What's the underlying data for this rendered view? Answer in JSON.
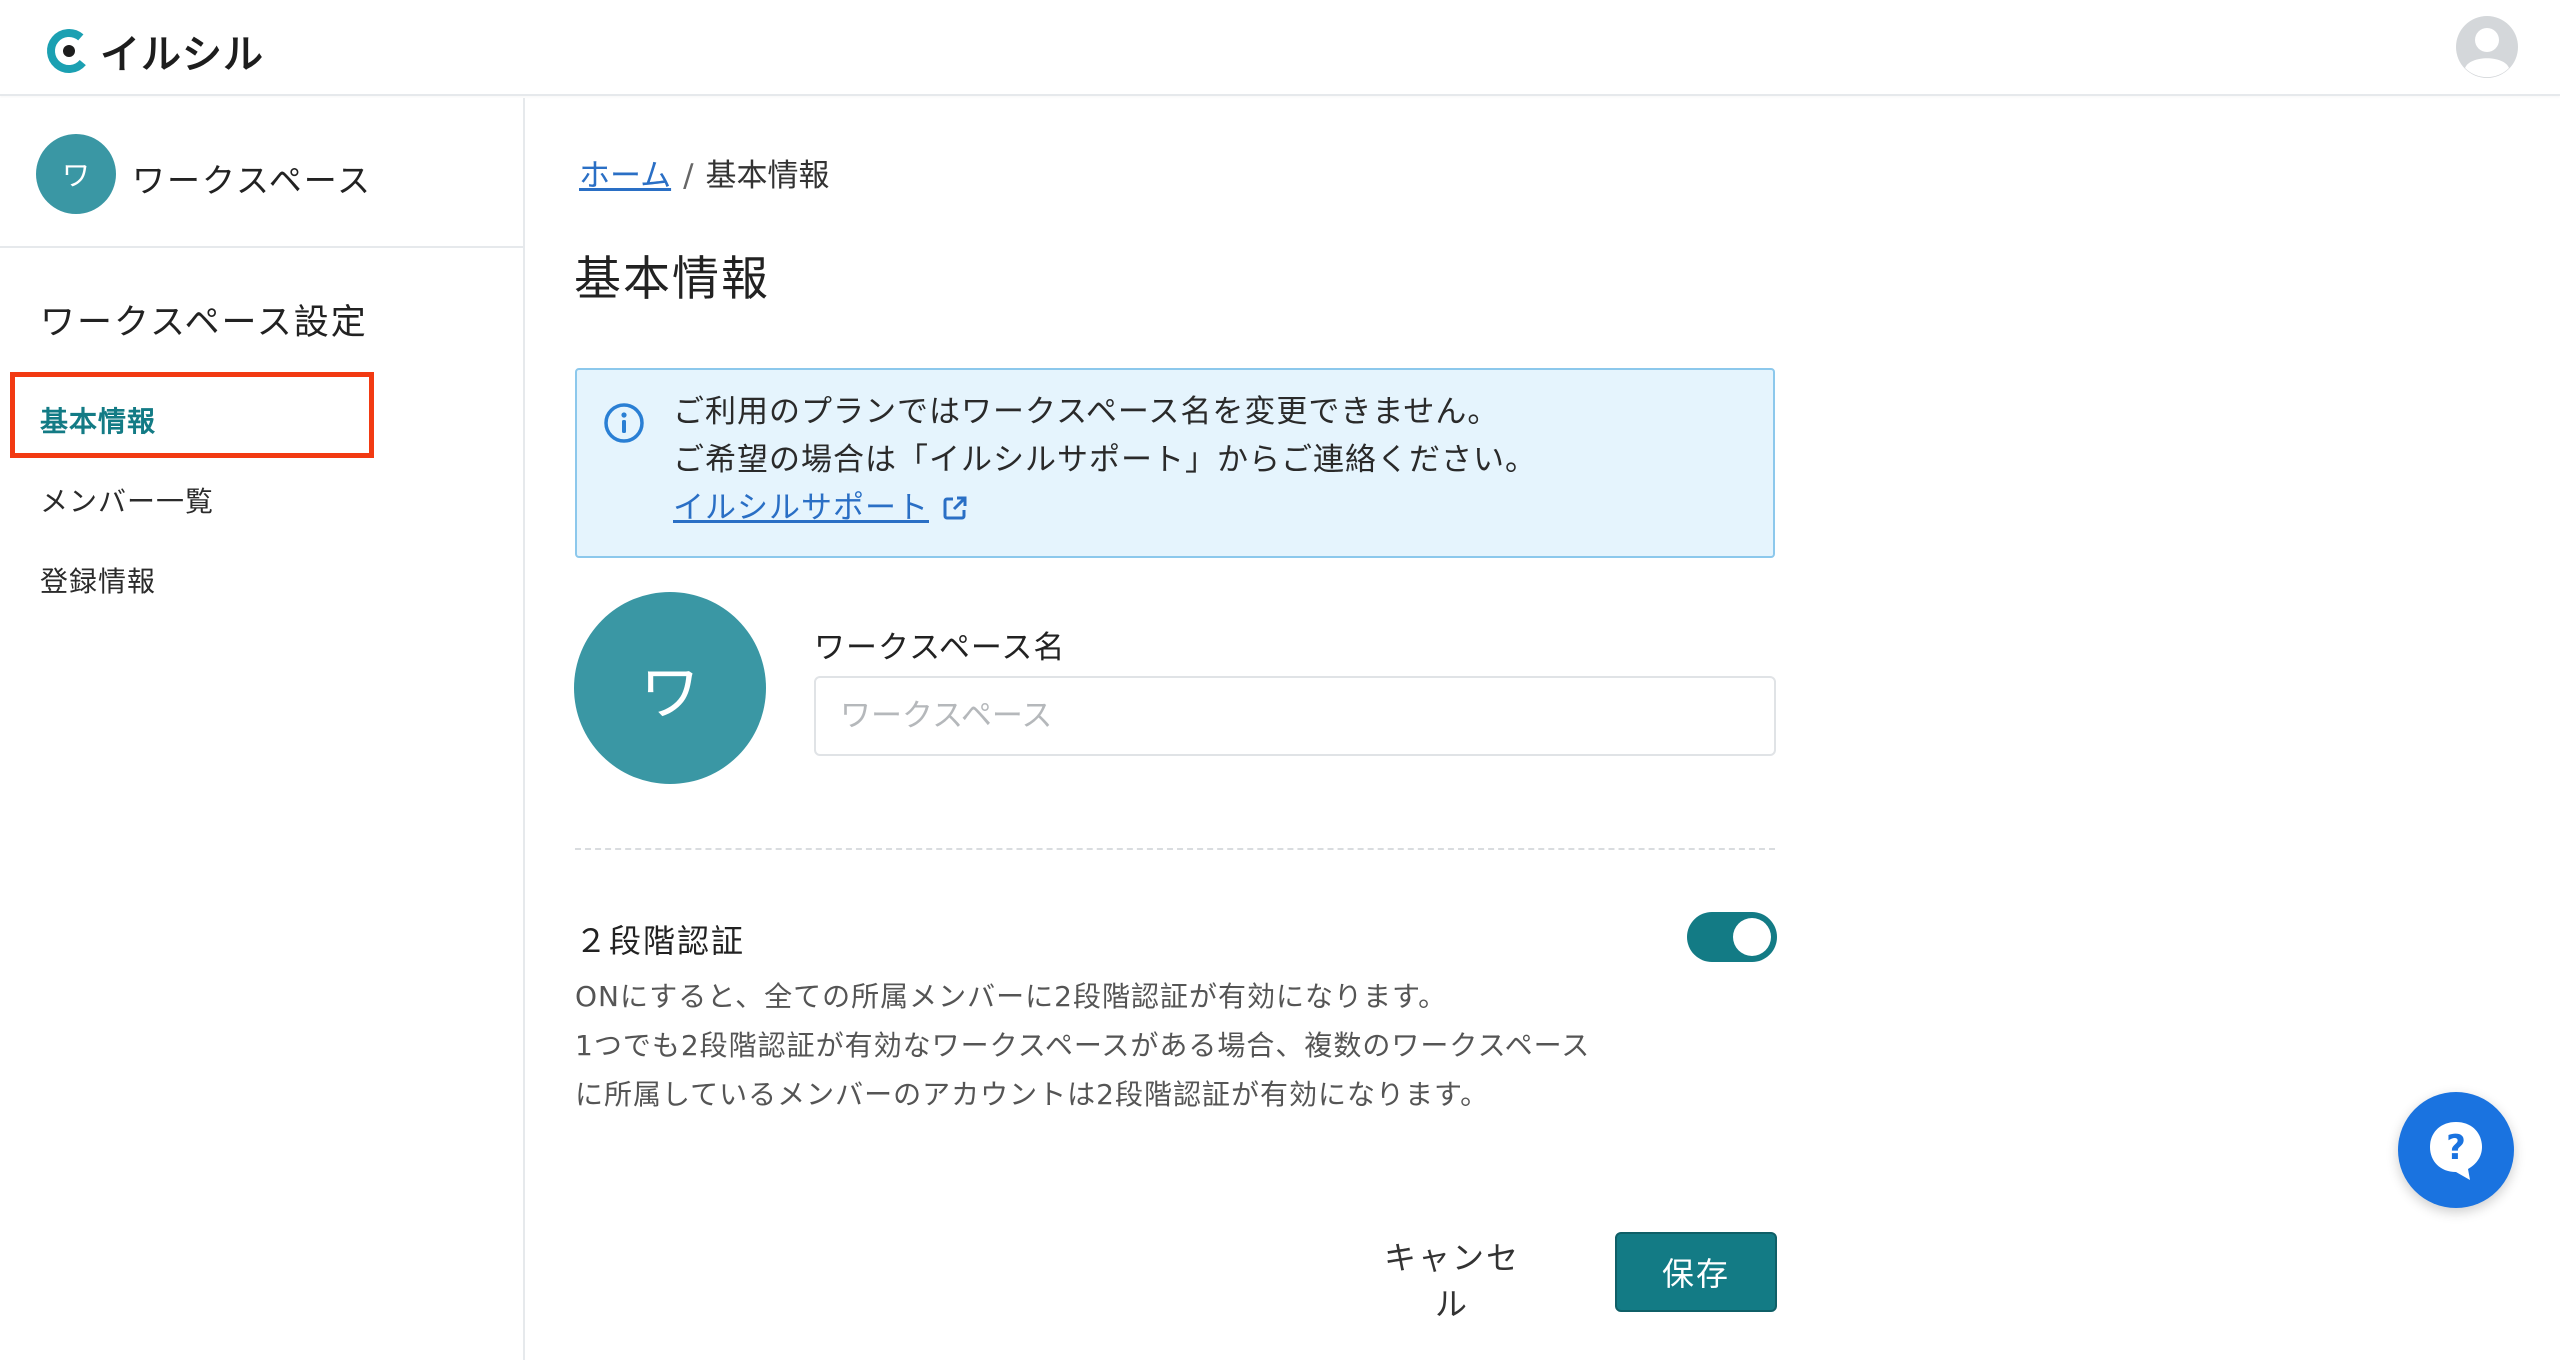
{
  "header": {
    "logo_text": "イルシル",
    "brand_color": "#1ba0b2",
    "avatar_icon": "user-avatar-icon"
  },
  "sidebar": {
    "workspace_avatar": "ワ",
    "workspace_name": "ワークスペース",
    "section_title": "ワークスペース設定",
    "items": [
      {
        "label": "基本情報",
        "active": true
      },
      {
        "label": "メンバー一覧",
        "active": false
      },
      {
        "label": "登録情報",
        "active": false
      }
    ]
  },
  "breadcrumb": {
    "home": "ホーム",
    "separator": "/",
    "current": "基本情報"
  },
  "page_title": "基本情報",
  "info": {
    "line1": "ご利用のプランではワークスペース名を変更できません。",
    "line2": "ご希望の場合は「イルシルサポート」からご連絡ください。",
    "link": "イルシルサポート"
  },
  "workspace": {
    "avatar_letter": "ワ",
    "name_label": "ワークスペース名",
    "name_placeholder": "ワークスペース",
    "name_value": ""
  },
  "two_factor": {
    "title": "２段階認証",
    "enabled": true,
    "desc_line1": "ONにすると、全ての所属メンバーに2段階認証が有効になります。",
    "desc_line2": "1つでも2段階認証が有効なワークスペースがある場合、複数のワークスペース",
    "desc_line3": "に所属しているメンバーのアカウントは2段階認証が有効になります。"
  },
  "actions": {
    "cancel": "キャンセル",
    "save": "保存"
  },
  "colors": {
    "accent": "#137b85",
    "avatar": "#3a97a4",
    "link": "#2a6fc5",
    "info_bg": "#e5f4fd",
    "highlight": "#f23a12",
    "help_fab": "#1a73e0"
  }
}
